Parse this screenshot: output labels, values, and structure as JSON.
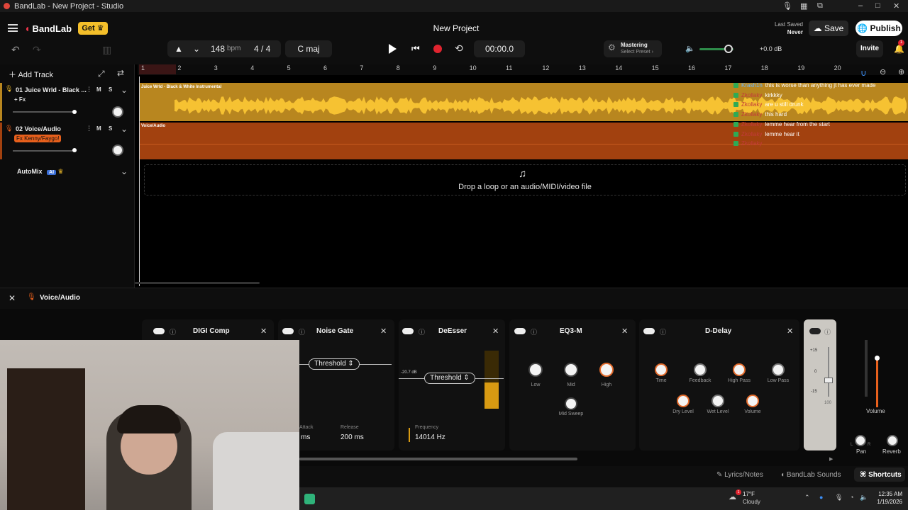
{
  "window": {
    "title": "BandLab - New Project - Studio",
    "controls": [
      "–",
      "□",
      "✕"
    ]
  },
  "header": {
    "brand": "BandLab",
    "get_label": "Get",
    "project_title": "New Project",
    "last_saved_label": "Last Saved",
    "last_saved_value": "Never",
    "save_label": "Save",
    "publish_label": "Publish"
  },
  "toolbar": {
    "bpm": "148",
    "bpm_unit": "bpm",
    "time_signature": "4 / 4",
    "key": "C maj",
    "time": "00:00.0",
    "mastering_label": "Mastering",
    "mastering_preset": "Select Preset",
    "master_db": "+0.0 dB",
    "invite_label": "Invite",
    "notification_count": "1"
  },
  "tracks_panel": {
    "add_track_label": "Add Track",
    "tracks": [
      {
        "name": "01  Juice Wrld - Black ...",
        "fx": "+ Fx",
        "mute": "M",
        "solo": "S"
      },
      {
        "name": "02  Voice/Audio",
        "fx": "Fx Kenny/Faygo!",
        "mute": "M",
        "solo": "S"
      }
    ],
    "automix_label": "AutoMix",
    "automix_badge": "AI"
  },
  "timeline": {
    "bars": [
      "1",
      "2",
      "3",
      "4",
      "5",
      "6",
      "7",
      "8",
      "9",
      "10",
      "11",
      "12",
      "13",
      "14",
      "15",
      "16",
      "17",
      "18",
      "19",
      "20"
    ],
    "clip1_label": "Juice Wrld - Black & White Instrumental",
    "clip2_label": "Voice/Audio",
    "drop_text": "Drop a loop or an audio/MIDI/video file"
  },
  "chat": [
    {
      "user": "Krash1n",
      "msg": "this is worse than anything jt has ever made",
      "color": "blue"
    },
    {
      "user": "Zkollaky",
      "msg": "kirkkky",
      "color": "red"
    },
    {
      "user": "Zkollaky",
      "msg": "are u still drunk",
      "color": "red"
    },
    {
      "user": "Zkollaky",
      "msg": "this hard",
      "color": "red"
    },
    {
      "user": "Zkollaky",
      "msg": "lemme hear from the start",
      "color": "red"
    },
    {
      "user": "Zkollaky",
      "msg": "lemme hear it",
      "color": "red"
    },
    {
      "user": "Zkollaky",
      "msg": "",
      "color": "red"
    }
  ],
  "fx_panel": {
    "track_label": "Voice/Audio",
    "effects": [
      {
        "name": "DIGI Comp"
      },
      {
        "name": "Noise Gate",
        "threshold": "Threshold",
        "attack_label": "Attack",
        "attack_value": "ms",
        "release_label": "Release",
        "release_value": "200 ms"
      },
      {
        "name": "DeEsser",
        "threshold": "Threshold",
        "db_readout": "-20.7 dB",
        "freq_label": "Frequency",
        "freq_value": "14014 Hz"
      },
      {
        "name": "EQ3-M",
        "knobs": [
          "Low",
          "Mid",
          "High",
          "Mid Sweep"
        ]
      },
      {
        "name": "D-Delay",
        "knobs": [
          "Time",
          "Feedback",
          "High Pass",
          "Low Pass",
          "Dry Level",
          "Wet Level",
          "Volume"
        ]
      }
    ],
    "meter_ticks": [
      "+15",
      "0",
      "-15"
    ],
    "meter_level": "100",
    "volume_label": "Volume",
    "pan_label": "Pan",
    "reverb_label": "Reverb",
    "pan_marks": [
      "L",
      "R"
    ]
  },
  "statusbar": {
    "lyrics_label": "Lyrics/Notes",
    "sounds_label": "BandLab Sounds",
    "shortcuts_label": "Shortcuts"
  },
  "taskbar": {
    "weather_temp": "17°F",
    "weather_desc": "Cloudy",
    "weather_badge": "1",
    "time": "12:35 AM",
    "date": "1/19/2026"
  },
  "colors": {
    "brand": "#f3364b",
    "gold": "#f4bf2a",
    "track1": "#b8861f",
    "track2": "#a2410f",
    "record": "#e0242f"
  }
}
